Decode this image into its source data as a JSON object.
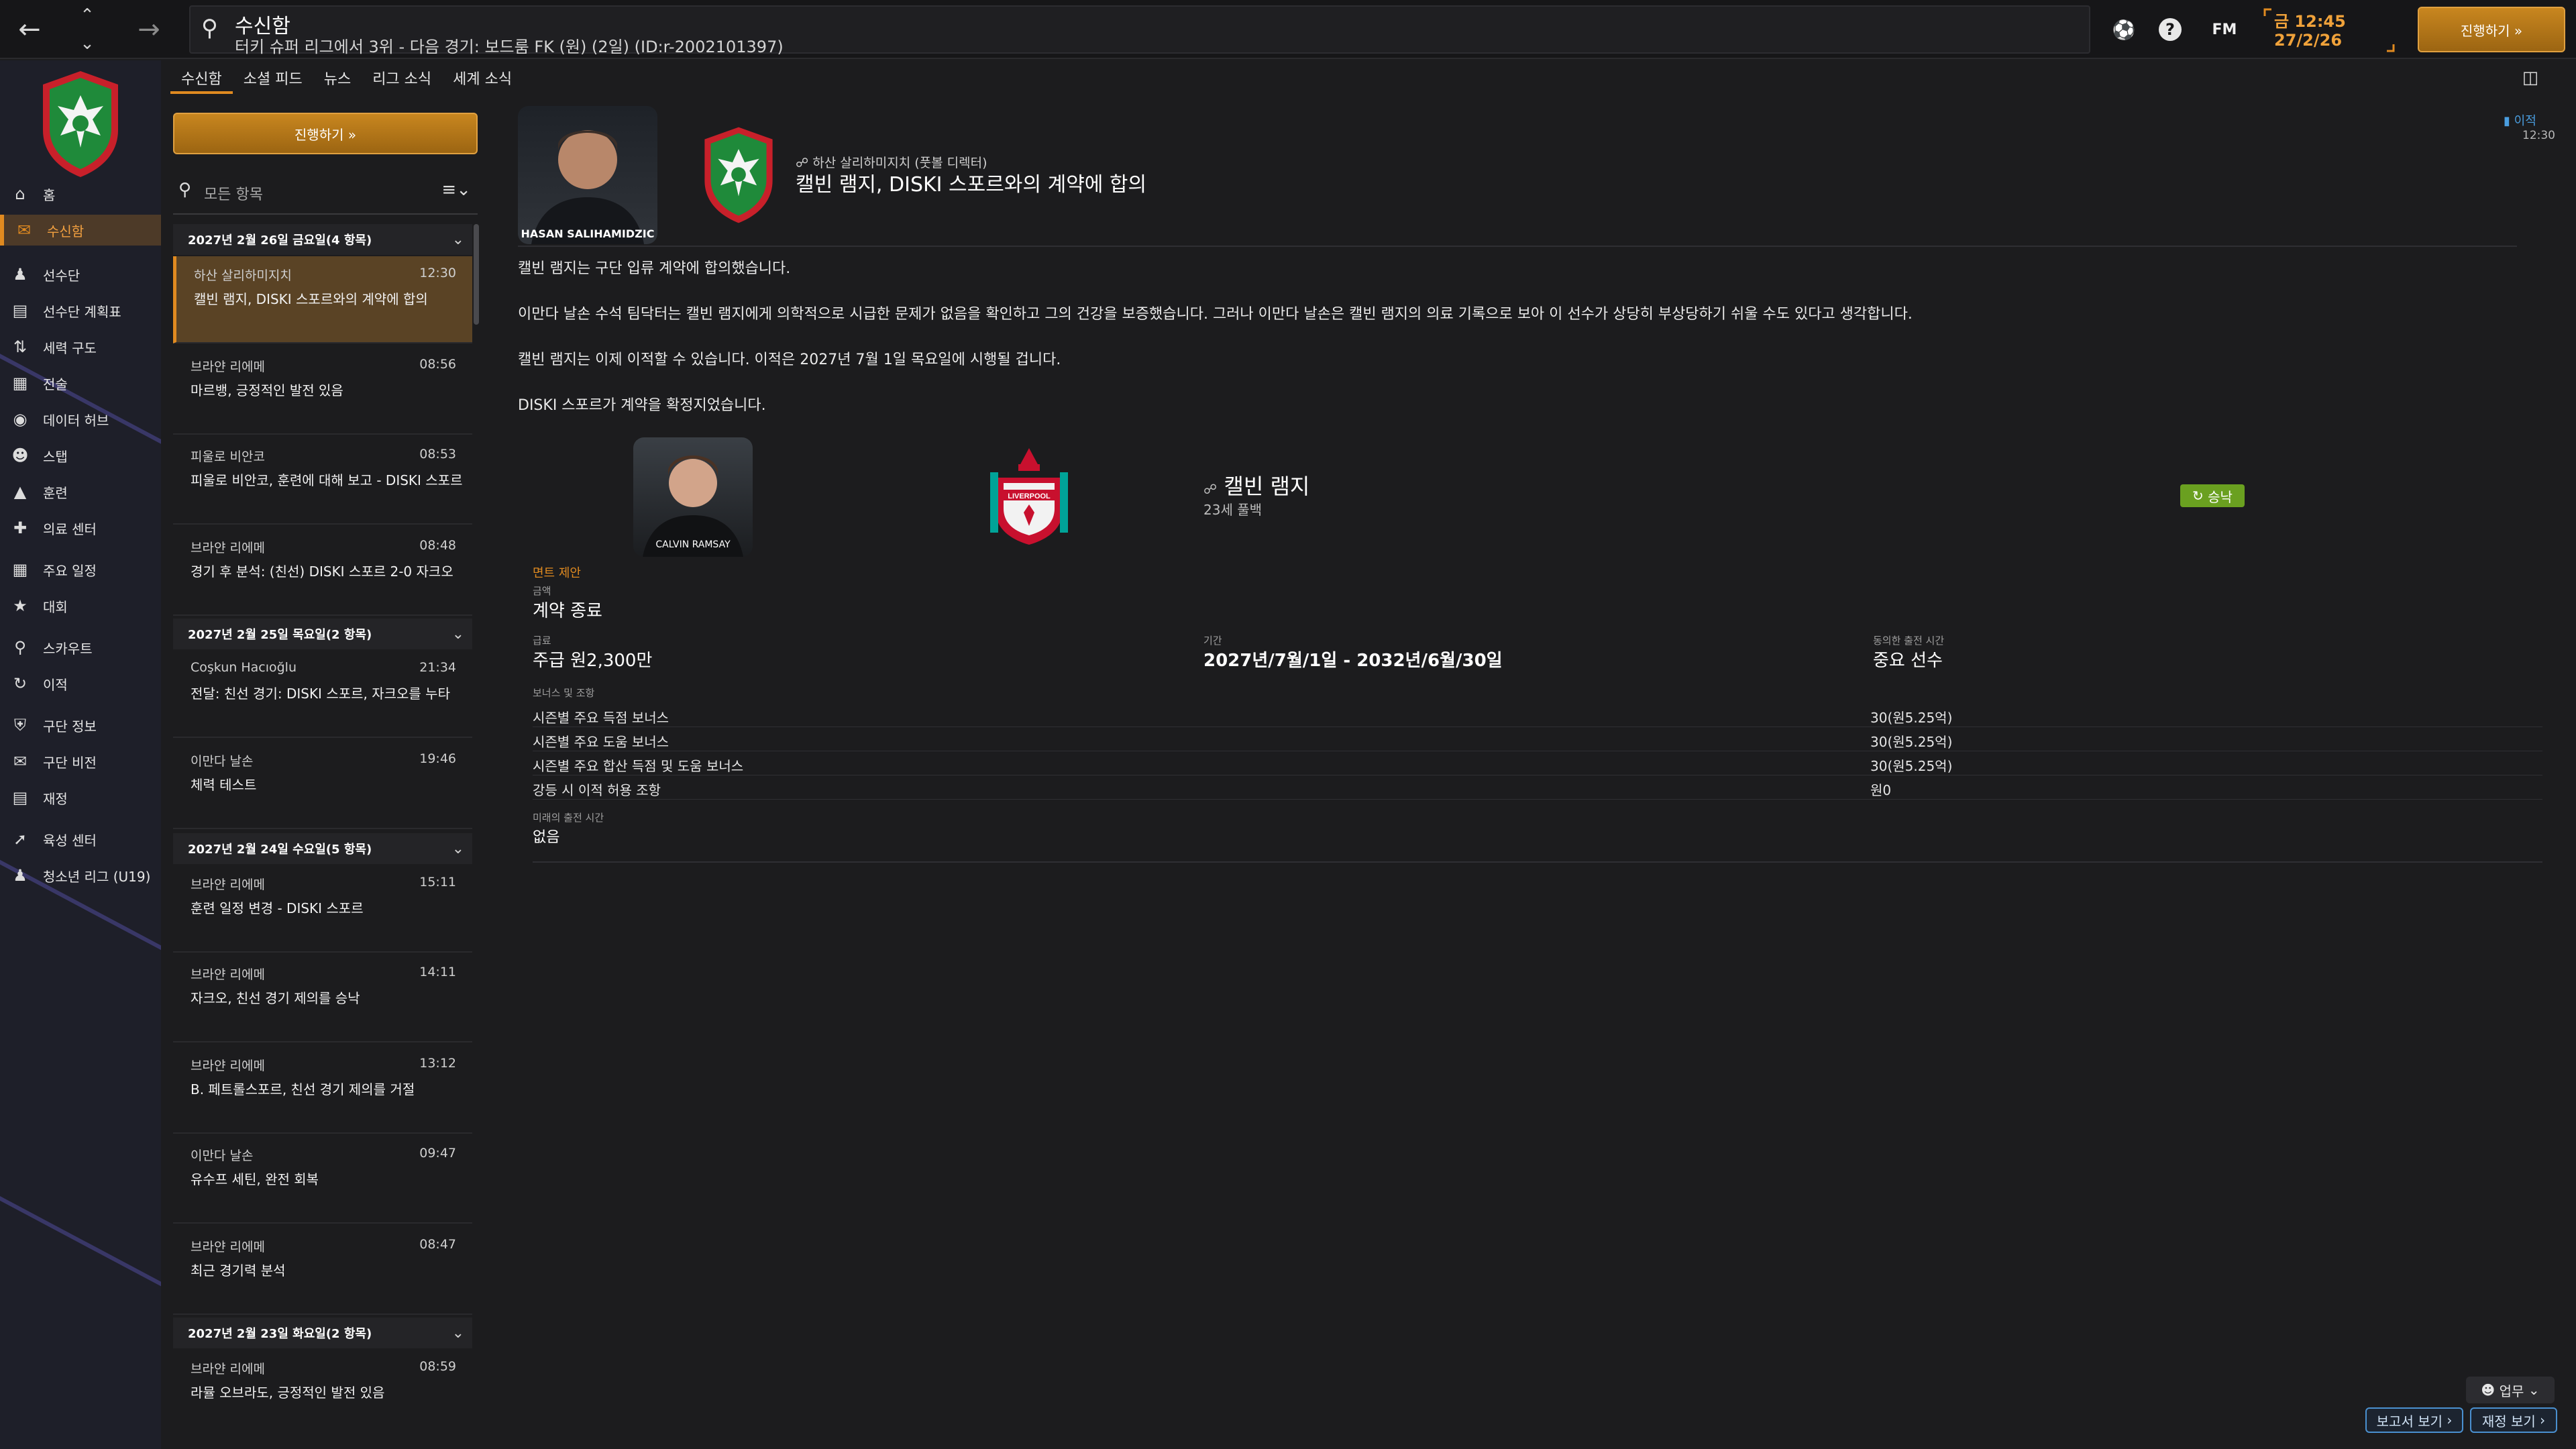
{
  "topbar": {
    "title": "수신함",
    "subtitle": "터키 슈퍼 리그에서 3위 - 다음 경기: 보드룸 FK (원) (2일) (ID:r-2002101397)",
    "fm_label": "FM",
    "time": "금 12:45",
    "date": "27/2/26",
    "continue_label": "진행하기 »"
  },
  "sidebar": {
    "items": [
      {
        "label": "홈",
        "icon": "home-icon"
      },
      {
        "label": "수신함",
        "icon": "inbox-icon"
      },
      {
        "label": "선수단",
        "icon": "squad-icon"
      },
      {
        "label": "선수단 계획표",
        "icon": "clipboard-icon"
      },
      {
        "label": "세력 구도",
        "icon": "dynamics-icon"
      },
      {
        "label": "전술",
        "icon": "tactics-icon"
      },
      {
        "label": "데이터 허브",
        "icon": "data-hub-icon"
      },
      {
        "label": "스탭",
        "icon": "staff-icon"
      },
      {
        "label": "훈련",
        "icon": "training-icon"
      },
      {
        "label": "의료 센터",
        "icon": "medical-icon"
      },
      {
        "label": "주요 일정",
        "icon": "calendar-icon"
      },
      {
        "label": "대회",
        "icon": "trophy-icon"
      },
      {
        "label": "스카우트",
        "icon": "scouting-icon"
      },
      {
        "label": "이적",
        "icon": "transfer-icon"
      },
      {
        "label": "구단 정보",
        "icon": "club-info-icon"
      },
      {
        "label": "구단 비전",
        "icon": "club-vision-icon"
      },
      {
        "label": "재정",
        "icon": "finance-icon"
      },
      {
        "label": "육성 센터",
        "icon": "development-icon"
      },
      {
        "label": "청소년 리그 (U19)",
        "icon": "youth-icon"
      }
    ]
  },
  "inbox": {
    "tabs": [
      "수신함",
      "소셜 피드",
      "뉴스",
      "리그 소식",
      "세계 소식"
    ],
    "continue_label": "진행하기 »",
    "filter_placeholder": "모든 항목",
    "groups": [
      {
        "header": "2027년 2월 26일 금요일(4 항목)",
        "messages": [
          {
            "from": "하산 살리하미지치",
            "time": "12:30",
            "subject": "캘빈 램지, DISKI 스포르와의 계약에 합의"
          },
          {
            "from": "브라얀 리에메",
            "time": "08:56",
            "subject": "마르뱅, 긍정적인 발전 있음"
          },
          {
            "from": "피울로 비안코",
            "time": "08:53",
            "subject": "피울로 비안코, 훈련에 대해 보고 - DISKI 스포르"
          },
          {
            "from": "브라얀 리에메",
            "time": "08:48",
            "subject": "경기 후 분석: (친선) DISKI 스포르 2-0 자크오"
          }
        ]
      },
      {
        "header": "2027년 2월 25일 목요일(2 항목)",
        "messages": [
          {
            "from": "Coşkun Hacıoğlu",
            "time": "21:34",
            "subject": "전달: 친선 경기: DISKI 스포르, 자크오를 누타"
          },
          {
            "from": "이만다 날손",
            "time": "19:46",
            "subject": "체력 테스트"
          }
        ]
      },
      {
        "header": "2027년 2월 24일 수요일(5 항목)",
        "messages": [
          {
            "from": "브라얀 리에메",
            "time": "15:11",
            "subject": "훈련 일정 변경 - DISKI 스포르"
          },
          {
            "from": "브라얀 리에메",
            "time": "14:11",
            "subject": "자크오, 친선 경기 제의를 승낙"
          },
          {
            "from": "브라얀 리에메",
            "time": "13:12",
            "subject": "B. 페트롤스포르, 친선 경기 제의를 거절"
          },
          {
            "from": "이만다 날손",
            "time": "09:47",
            "subject": "유수프 세틴, 완전 회복"
          },
          {
            "from": "브라얀 리에메",
            "time": "08:47",
            "subject": "최근 경기력 분석"
          }
        ]
      },
      {
        "header": "2027년 2월 23일 화요일(2 항목)",
        "messages": [
          {
            "from": "브라얀 리에메",
            "time": "08:59",
            "subject": "라뮬 오브라도, 긍정적인 발전 있음"
          }
        ]
      }
    ]
  },
  "message": {
    "sender_name": "HASAN SALIHAMIDZIC",
    "sender_line": "하산 살리하미지치 (풋볼 디렉터)",
    "headline": "캘빈 램지, DISKI 스포르와의 계약에 합의",
    "top_right_label": "이적",
    "top_right_time": "12:30",
    "paragraphs": [
      "캘빈 램지는 구단 입류 계약에 합의했습니다.",
      "이만다 날손 수석 팀닥터는 캘빈 램지에게 의학적으로 시급한 문제가 없음을 확인하고 그의 건강을 보증했습니다. 그러나 이만다 날손은 캘빈 램지의 의료 기록으로 보아 이 선수가 상당히 부상당하기 쉬울 수도 있다고 생각합니다.",
      "캘빈 램지는 이제 이적할 수 있습니다. 이적은 2027년 7월 1일 목요일에 시행될 겁니다.",
      "DISKI 스포르가 계약을 확정지었습니다."
    ],
    "player": {
      "card_name": "CALVIN RAMSAY",
      "name": "캘빈 램지",
      "age_position": "23세 풀백",
      "club_badge_text": "LIVERPOOL",
      "status": "승낙"
    },
    "contract": {
      "offer_label": "면트 제안",
      "type_label": "금액",
      "type_value": "계약 종료",
      "wage_label": "급료",
      "wage_value": "주급 원2,300만",
      "period_label": "기간",
      "period_value": "2027년/7월/1일 - 2032년/6월/30일",
      "role_label": "동의한 출전 시간",
      "role_value": "중요 선수",
      "bonus_label": "보너스 및 조항",
      "bonuses": [
        {
          "name": "시즌별 주요 득점 보너스",
          "value": "30(원5.25억)"
        },
        {
          "name": "시즌별 주요 도움 보너스",
          "value": "30(원5.25억)"
        },
        {
          "name": "시즌별 주요 합산 득점 및 도움 보너스",
          "value": "30(원5.25억)"
        },
        {
          "name": "강등 시 이적 허용 조항",
          "value": "원0"
        }
      ],
      "future_label": "미래의 출전 시간",
      "future_value": "없음"
    }
  },
  "footer": {
    "work_label": "업무",
    "report_label": "보고서 보기",
    "finance_label": "재정 보기"
  },
  "colors": {
    "accent": "#e08a20",
    "accepted": "#6aa020",
    "link": "#4a90d0"
  }
}
